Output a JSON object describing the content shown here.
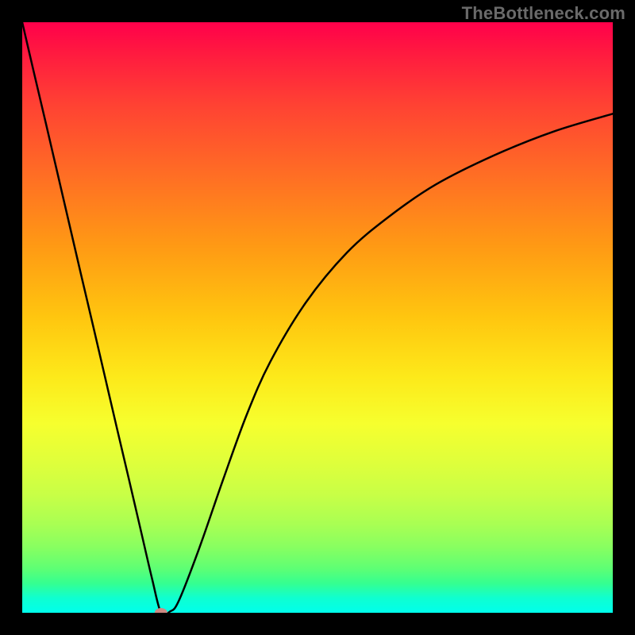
{
  "attribution": "TheBottleneck.com",
  "chart_data": {
    "type": "line",
    "title": "",
    "xlabel": "",
    "ylabel": "",
    "ylim": [
      0,
      100
    ],
    "x": [
      0,
      2,
      4,
      6,
      8,
      10,
      12,
      14,
      16,
      18,
      20,
      22,
      23.5,
      25,
      26.5,
      30,
      34,
      38,
      42,
      48,
      55,
      62,
      70,
      80,
      90,
      100
    ],
    "series": [
      {
        "name": "curve",
        "values": [
          100,
          91.4,
          82.9,
          74.3,
          65.7,
          57.1,
          48.6,
          40.0,
          31.4,
          22.9,
          14.3,
          5.7,
          0,
          0.2,
          2.0,
          11.0,
          22.5,
          33.5,
          42.5,
          52.5,
          61.0,
          67.0,
          72.5,
          77.5,
          81.5,
          84.5
        ]
      }
    ],
    "marker": {
      "x": 23.5,
      "y": 0
    },
    "background": "rainbow-vertical-gradient"
  }
}
